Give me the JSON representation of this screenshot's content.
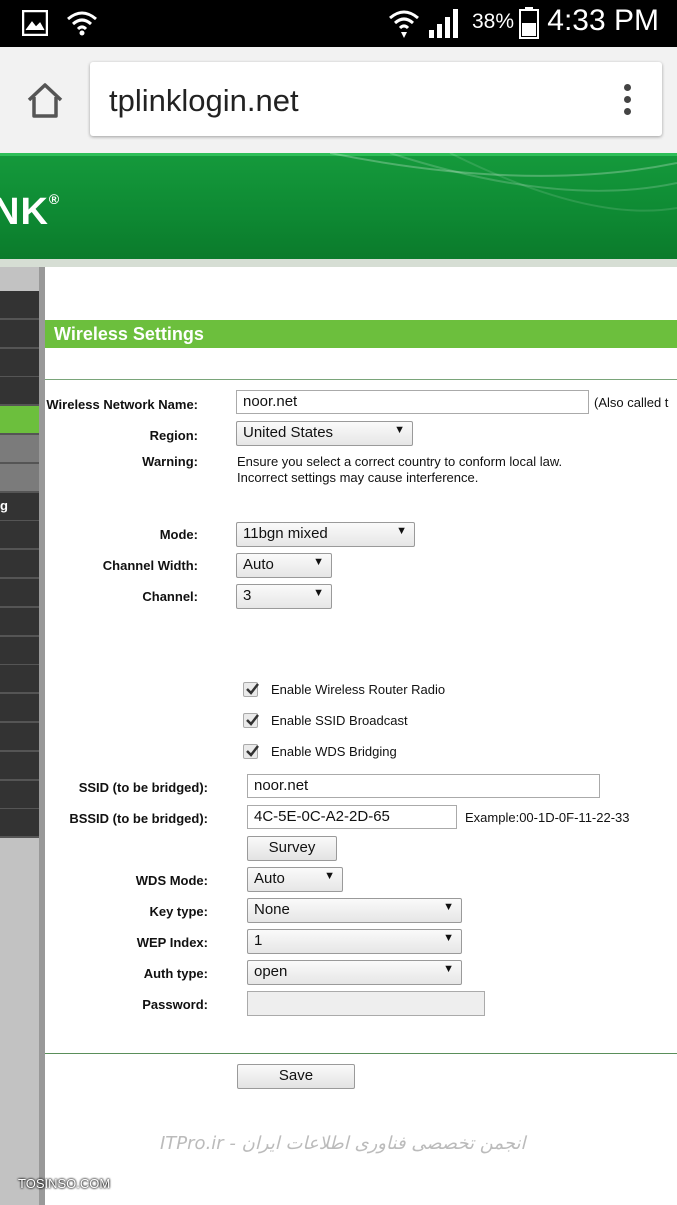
{
  "statusbar": {
    "battery_percent": "38%",
    "time": "4:33 PM",
    "icons": [
      "gallery-icon",
      "wifi-calling-icon",
      "wifi-icon",
      "cell-signal-icon",
      "battery-icon"
    ]
  },
  "browser": {
    "url": "tplinklogin.net",
    "icons": [
      "home-icon",
      "overflow-menu-icon"
    ]
  },
  "banner": {
    "logo_text": "NK",
    "logo_mark": "®"
  },
  "sidebar": {
    "items": [
      {
        "label": ""
      },
      {
        "label": ""
      },
      {
        "label": ""
      },
      {
        "label": ""
      },
      {
        "label": "",
        "active": true
      },
      {
        "label": ""
      },
      {
        "label": ""
      },
      {
        "label": "g"
      },
      {
        "label": ""
      },
      {
        "label": ""
      },
      {
        "label": ""
      },
      {
        "label": ""
      },
      {
        "label": ""
      },
      {
        "label": ""
      },
      {
        "label": ""
      },
      {
        "label": ""
      },
      {
        "label": ""
      },
      {
        "label": ""
      },
      {
        "label": ""
      }
    ]
  },
  "page": {
    "section_title": "Wireless Settings",
    "network_name_label": "Wireless Network Name:",
    "network_name_value": "noor.net",
    "network_name_note": "(Also called t",
    "region_label": "Region:",
    "region_value": "United States",
    "warning_label": "Warning:",
    "warning_line1": "Ensure you select a correct country to conform local law.",
    "warning_line2": "Incorrect settings may cause interference.",
    "mode_label": "Mode:",
    "mode_value": "11bgn mixed",
    "channel_width_label": "Channel Width:",
    "channel_width_value": "Auto",
    "channel_label": "Channel:",
    "channel_value": "3",
    "enable_radio_label": "Enable Wireless Router Radio",
    "enable_ssid_label": "Enable SSID Broadcast",
    "enable_wds_label": "Enable WDS Bridging",
    "ssid_bridged_label": "SSID (to be bridged):",
    "ssid_bridged_value": "noor.net",
    "bssid_bridged_label": "BSSID (to be bridged):",
    "bssid_bridged_value": "4C-5E-0C-A2-2D-65",
    "bssid_example": "Example:00-1D-0F-11-22-33",
    "survey_button": "Survey",
    "wds_mode_label": "WDS Mode:",
    "wds_mode_value": "Auto",
    "key_type_label": "Key type:",
    "key_type_value": "None",
    "wep_index_label": "WEP Index:",
    "wep_index_value": "1",
    "auth_type_label": "Auth type:",
    "auth_type_value": "open",
    "password_label": "Password:",
    "password_value": "",
    "save_button": "Save"
  },
  "watermarks": {
    "itpro": "ITPro.ir - انجمن تخصصی فناوری اطلاعات ایران",
    "tosinso": "TOSINSO.COM"
  }
}
